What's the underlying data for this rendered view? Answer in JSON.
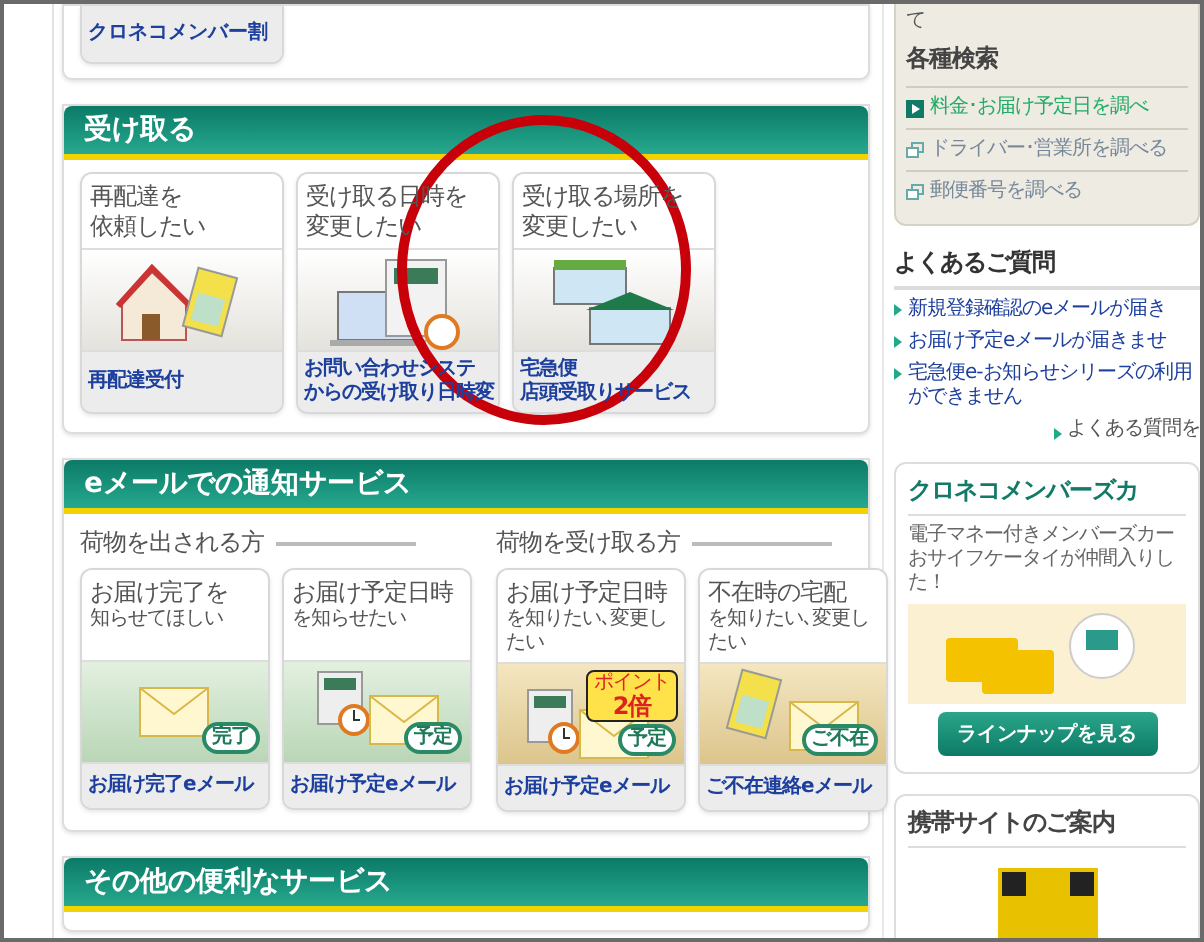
{
  "top_card": {
    "link": "クロネコメンバー割"
  },
  "sections": [
    {
      "kind": "receive",
      "title": "受け取る",
      "groups": [
        {
          "cards": [
            {
              "title": "再配達を",
              "subtitle": "依頼したい",
              "kind": "house",
              "link": [
                "再配達受付"
              ]
            },
            {
              "title": "受け取る日時を",
              "subtitle": "変更したい",
              "kind": "calendar",
              "link": [
                "お問い合わせシステ",
                "からの受け取り日時変"
              ]
            },
            {
              "title": "受け取る場所を",
              "subtitle": "変更したい",
              "kind": "stores",
              "link": [
                "宅急便",
                "店頭受取りサービス"
              ]
            }
          ]
        }
      ]
    },
    {
      "kind": "email",
      "title": "eメールでの通知サービス",
      "groups": [
        {
          "heading": "荷物を出される方",
          "cards": [
            {
              "title": "お届け完了を",
              "subtitle": "知らせてほしい",
              "kind": "envelope",
              "badge": "完了",
              "link": [
                "お届け完了eメール"
              ]
            },
            {
              "title": "お届け予定日時",
              "subtitle": "を知らせたい",
              "kind": "calendar-envelope",
              "badge": "予定",
              "link": [
                "お届け予定eメール"
              ]
            }
          ]
        },
        {
          "heading": "荷物を受け取る方",
          "cards": [
            {
              "title": "お届け予定日時",
              "subtitle": "を知りたい､変更したい",
              "kind": "calendar-envelope-point",
              "badge": "予定",
              "point": {
                "top": "ポイント",
                "main": "2倍"
              },
              "link": [
                "お届け予定eメール"
              ]
            },
            {
              "title": "不在時の宅配",
              "subtitle": "を知りたい､変更したい",
              "kind": "slip-envelope",
              "badge": "ご不在",
              "link": [
                "ご不在連絡eメール"
              ]
            }
          ]
        }
      ]
    },
    {
      "kind": "plain",
      "title": "その他の便利なサービス"
    }
  ],
  "sidebar": {
    "search_panel": {
      "cut_line": "て",
      "title": "各種検索",
      "links": [
        {
          "label": "料金･お届け予定日を調べ",
          "kind": "primary"
        },
        {
          "label": "ドライバー･営業所を調べる",
          "kind": "window"
        },
        {
          "label": "郵便番号を調べる",
          "kind": "window"
        }
      ]
    },
    "faq": {
      "title": "よくあるご質問",
      "items": [
        "新規登録確認のeメールが届き",
        "お届け予定eメールが届きませ",
        "宅急便e-お知らせシリーズの利用ができません"
      ],
      "more": "よくある質問を"
    },
    "members_card": {
      "title": "クロネコメンバーズカ",
      "lines": [
        "電子マネー付きメンバーズカー",
        "おサイフケータイが仲間入りし",
        "た！"
      ],
      "button": "ラインナップを見る"
    },
    "mobile": {
      "title": "携帯サイトのご案内"
    }
  }
}
